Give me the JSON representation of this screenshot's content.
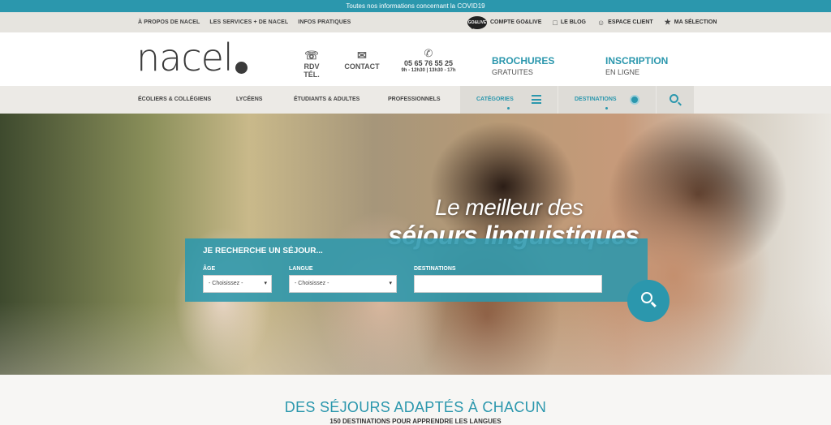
{
  "covid_banner": "Toutes nos informations concernant la COVID19",
  "util_nav": {
    "left": [
      "À PROPOS DE NACEL",
      "LES SERVICES + DE NACEL",
      "INFOS PRATIQUES"
    ],
    "golive_badge": "GO&LIVE",
    "compte": "COMPTE GO&LIVE",
    "blog": "LE BLOG",
    "espace_client": "ESPACE CLIENT",
    "selection": "MA SÉLECTION"
  },
  "header": {
    "logo": "nacel",
    "rdv": "RDV TÉL.",
    "contact": "CONTACT",
    "phone": "05 65 76 55 25",
    "hours": "9h - 12h30 | 13h30 - 17h",
    "brochures_title": "BROCHURES",
    "brochures_sub": "GRATUITES",
    "inscription_title": "INSCRIPTION",
    "inscription_sub": "EN LIGNE"
  },
  "nav": {
    "items": [
      "ÉCOLIERS & COLLÉGIENS",
      "LYCÉENS",
      "ÉTUDIANTS & ADULTES",
      "PROFESSIONNELS"
    ],
    "categories": "CATÉGORIES",
    "destinations": "DESTINATIONS"
  },
  "hero": {
    "line1": "Le meilleur des",
    "line2": "séjours linguistiques",
    "search_title": "JE RECHERCHE UN SÉJOUR...",
    "age_label": "ÂGE",
    "age_value": "- Choisissez -",
    "langue_label": "LANGUE",
    "langue_value": "- Choisissez -",
    "destinations_label": "DESTINATIONS",
    "destinations_value": ""
  },
  "section": {
    "title": "DES SÉJOURS ADAPTÉS À CHACUN",
    "subtitle": "150 DESTINATIONS POUR APPRENDRE LES LANGUES"
  },
  "colors": {
    "accent": "#2b97ad",
    "topbar": "#e6e4df",
    "nav": "#eceae6"
  }
}
